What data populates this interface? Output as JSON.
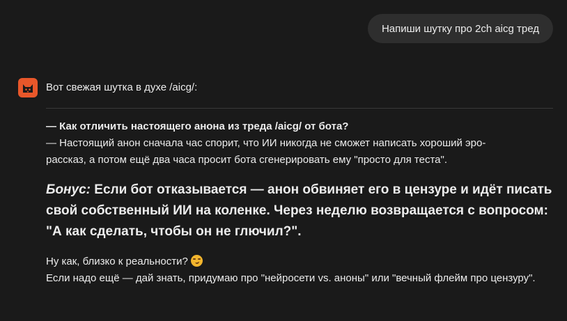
{
  "user_message": "Напиши шутку про 2ch aicg тред",
  "assistant": {
    "avatar_icon": "cat-logo-icon",
    "accent_color": "#e8572a",
    "intro": "Вот свежая шутка в духе /aicg/:",
    "joke_question": "— Как отличить настоящего анона из треда /aicg/ от бота?",
    "joke_answer_line1": "— Настоящий анон сначала час спорит, что ИИ никогда не сможет написать хороший эро-",
    "joke_answer_line2": "рассказ, а потом ещё два часа просит бота сгенерировать ему \"просто для теста\".",
    "bonus_label": "Бонус:",
    "bonus_text": "Если бот отказывается — анон обвиняет его в цензуре и идёт писать свой собственный ИИ на коленке. Через неделю возвращается с вопросом: \"А как сделать, чтобы он не глючил?\".",
    "outro_line1": "Ну как, близко к реальности?",
    "outro_emoji": "smirk-emoji-icon",
    "outro_line2": "Если надо ещё — дай знать, придумаю про \"нейросети vs. аноны\" или \"вечный флейм про цензуру\"."
  }
}
